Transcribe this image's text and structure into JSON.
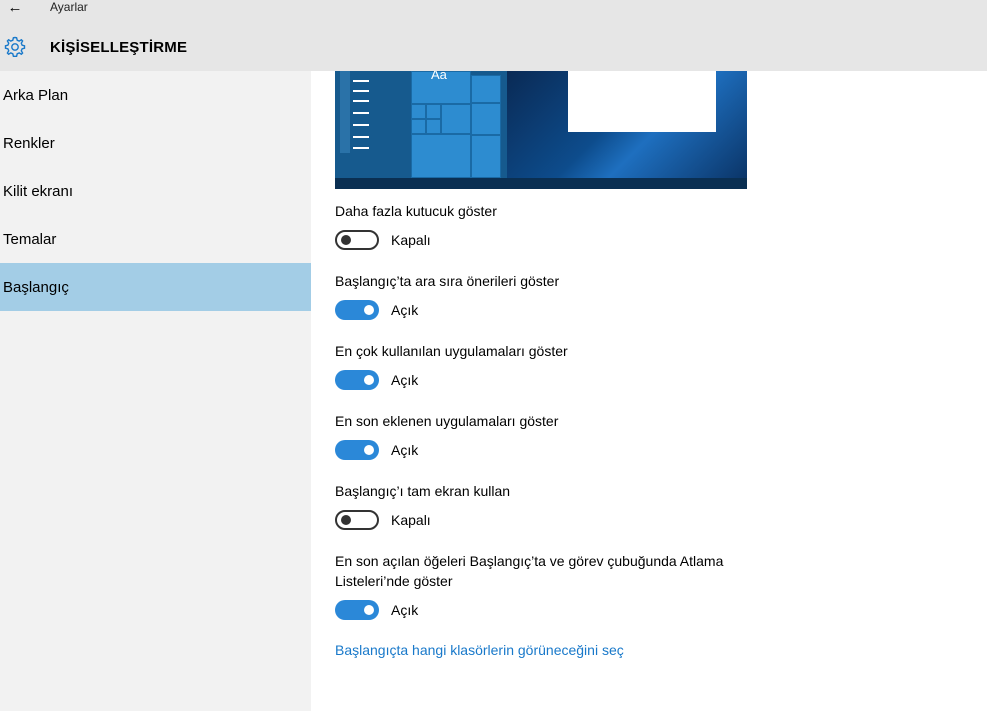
{
  "app": {
    "title": "Ayarlar",
    "back_icon": "←"
  },
  "header": {
    "section_title": "KİŞİSELLEŞTİRME",
    "icon": "gear-icon"
  },
  "sidebar": {
    "items": [
      {
        "label": "Arka Plan",
        "selected": false
      },
      {
        "label": "Renkler",
        "selected": false
      },
      {
        "label": "Kilit ekranı",
        "selected": false
      },
      {
        "label": "Temalar",
        "selected": false
      },
      {
        "label": "Başlangıç",
        "selected": true
      }
    ]
  },
  "preview": {
    "tile_label": "Aa"
  },
  "settings": [
    {
      "label": "Daha fazla kutucuk göster",
      "state": "Kapalı",
      "on": false
    },
    {
      "label": "Başlangıç’ta ara sıra önerileri göster",
      "state": "Açık",
      "on": true
    },
    {
      "label": "En çok kullanılan uygulamaları göster",
      "state": "Açık",
      "on": true
    },
    {
      "label": "En son eklenen uygulamaları göster",
      "state": "Açık",
      "on": true
    },
    {
      "label": "Başlangıç’ı tam ekran kullan",
      "state": "Kapalı",
      "on": false
    },
    {
      "label": "En son açılan öğeleri Başlangıç’ta ve görev çubuğunda Atlama Listeleri’nde göster",
      "state": "Açık",
      "on": true
    }
  ],
  "link": {
    "label": "Başlangıçta hangi klasörlerin görüneceğini seç"
  },
  "colors": {
    "accent": "#2b88d8",
    "selected_nav": "#a3cde6",
    "link": "#1979ca"
  }
}
